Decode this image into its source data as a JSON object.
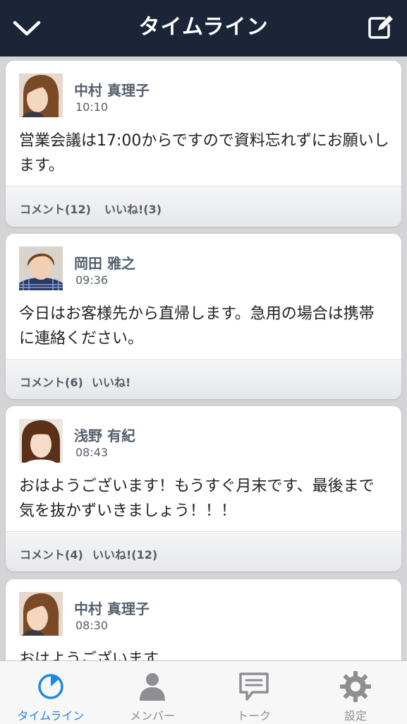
{
  "header": {
    "title": "タイムライン",
    "back_icon": "chevron-down-icon",
    "compose_icon": "compose-icon"
  },
  "posts": [
    {
      "name": "中村 真理子",
      "time": "10:10",
      "body": "営業会議は17:00からですので資料忘れずにお願いします。",
      "comment_label": "コメント(12)",
      "like_label": "いいね!(3)"
    },
    {
      "name": "岡田 雅之",
      "time": "09:36",
      "body": "今日はお客様先から直帰します。急用の場合は携帯に連絡ください。",
      "comment_label": "コメント(6)",
      "like_label": "いいね!"
    },
    {
      "name": "浅野 有紀",
      "time": "08:43",
      "body": "おはようございます！もうすぐ月末です、最後まで気を抜かずいきましょう！！！",
      "comment_label": "コメント(4)",
      "like_label": "いいね!(12)"
    },
    {
      "name": "中村 真理子",
      "time": "08:30",
      "body": "おはようございます"
    }
  ],
  "tabs": [
    {
      "label": "タイムライン",
      "icon": "timeline-icon",
      "active": true
    },
    {
      "label": "メンバー",
      "icon": "member-icon",
      "active": false
    },
    {
      "label": "トーク",
      "icon": "talk-icon",
      "active": false
    },
    {
      "label": "設定",
      "icon": "gear-icon",
      "active": false
    }
  ],
  "colors": {
    "header_bg": "#1c2538",
    "active_tab": "#1e88e5",
    "inactive_tab": "#8e8e93",
    "name_text": "#55606e"
  }
}
